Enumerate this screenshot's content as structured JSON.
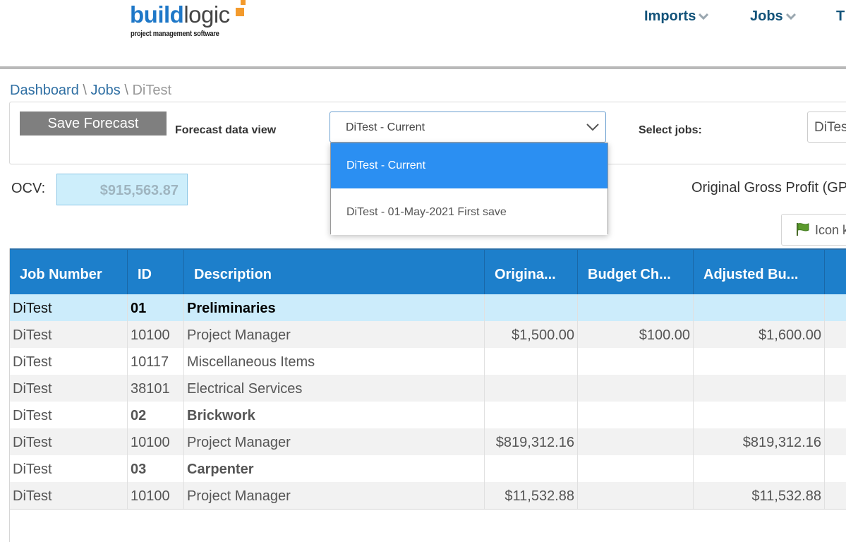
{
  "logo": {
    "word_bold": "build",
    "word_light": "logic",
    "tagline": "project management software"
  },
  "nav": {
    "imports": "Imports",
    "jobs": "Jobs",
    "third": "T"
  },
  "breadcrumb": {
    "dashboard": "Dashboard",
    "sep1": " \\ ",
    "jobs": "Jobs",
    "sep2": " \\ ",
    "current": "DiTest"
  },
  "toolbar": {
    "save_label": "Save Forecast",
    "forecast_view_label": "Forecast data view",
    "forecast_view_value": "DiTest - Current",
    "select_jobs_label": "Select jobs:",
    "select_jobs_value": "DiTes"
  },
  "dropdown": {
    "options": [
      {
        "label": "DiTest - Current",
        "selected": true
      },
      {
        "label": "DiTest - 01-May-2021 First save",
        "selected": false
      }
    ]
  },
  "summary": {
    "ocv_label": "OCV:",
    "ocv_value": "$915,563.87",
    "ogp_label": "Original Gross Profit (GP",
    "icon_button_label": "Icon k"
  },
  "grid": {
    "columns": [
      "Job Number",
      "ID",
      "Description",
      "Origina...",
      "Budget Ch...",
      "Adjusted Bu..."
    ],
    "rows": [
      {
        "job": "DiTest",
        "id": "01",
        "desc": "Preliminaries",
        "original": "",
        "budget_change": "",
        "adjusted": "",
        "group": true
      },
      {
        "job": "DiTest",
        "id": "10100",
        "desc": "Project Manager",
        "original": "$1,500.00",
        "budget_change": "$100.00",
        "adjusted": "$1,600.00",
        "group": false
      },
      {
        "job": "DiTest",
        "id": "10117",
        "desc": "Miscellaneous Items",
        "original": "",
        "budget_change": "",
        "adjusted": "",
        "group": false
      },
      {
        "job": "DiTest",
        "id": "38101",
        "desc": "Electrical Services",
        "original": "",
        "budget_change": "",
        "adjusted": "",
        "group": false
      },
      {
        "job": "DiTest",
        "id": "02",
        "desc": "Brickwork",
        "original": "",
        "budget_change": "",
        "adjusted": "",
        "group": true
      },
      {
        "job": "DiTest",
        "id": "10100",
        "desc": "Project Manager",
        "original": "$819,312.16",
        "budget_change": "",
        "adjusted": "$819,312.16",
        "group": false
      },
      {
        "job": "DiTest",
        "id": "03",
        "desc": "Carpenter",
        "original": "",
        "budget_change": "",
        "adjusted": "",
        "group": true
      },
      {
        "job": "DiTest",
        "id": "10100",
        "desc": "Project Manager",
        "original": "$11,532.88",
        "budget_change": "",
        "adjusted": "$11,532.88",
        "group": false
      }
    ]
  },
  "colors": {
    "header_blue": "#1d7fcb",
    "nav_text": "#13537a",
    "logo_blue": "#1f78c8",
    "logo_orange": "#f39a2c",
    "dropdown_selected": "#2b8ff2",
    "group_row": "#ccecfb"
  }
}
